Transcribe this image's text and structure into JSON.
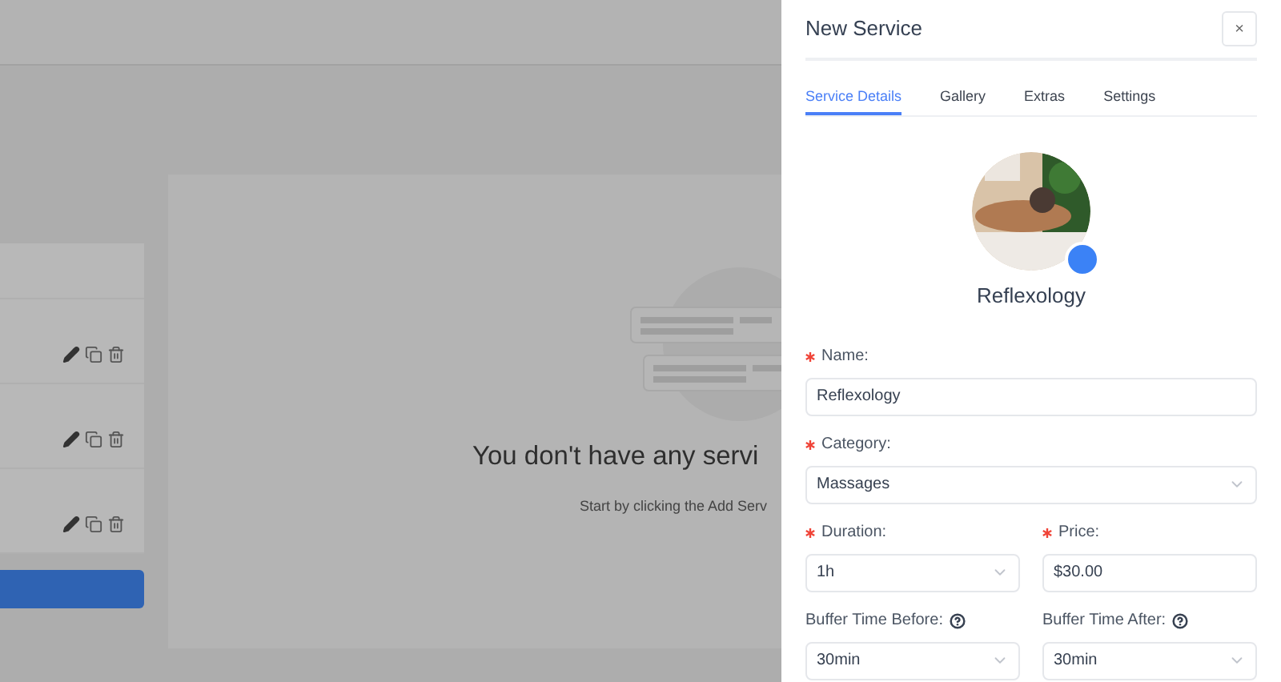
{
  "empty_state": {
    "title": "You don't have any servi",
    "subtitle": "Start by clicking the Add Serv"
  },
  "drawer": {
    "title": "New Service",
    "close": "×",
    "tabs": [
      {
        "label": "Service Details",
        "selected": true
      },
      {
        "label": "Gallery",
        "selected": false
      },
      {
        "label": "Extras",
        "selected": false
      },
      {
        "label": "Settings",
        "selected": false
      }
    ],
    "service_name": "Reflexology",
    "form_rows": [
      [
        {
          "label": "Name:",
          "required": true,
          "help": false,
          "kind": "input",
          "value": "Reflexology"
        }
      ],
      [
        {
          "label": "Category:",
          "required": true,
          "help": false,
          "kind": "select",
          "value": "Massages"
        }
      ],
      [
        {
          "label": "Duration:",
          "required": true,
          "help": false,
          "kind": "select",
          "value": "1h"
        },
        {
          "label": "Price:",
          "required": true,
          "help": false,
          "kind": "input",
          "value": "$30.00"
        }
      ],
      [
        {
          "label": "Buffer Time Before:",
          "required": false,
          "help": true,
          "kind": "select",
          "value": "30min"
        },
        {
          "label": "Buffer Time After:",
          "required": false,
          "help": true,
          "kind": "select",
          "value": "30min"
        }
      ]
    ]
  }
}
